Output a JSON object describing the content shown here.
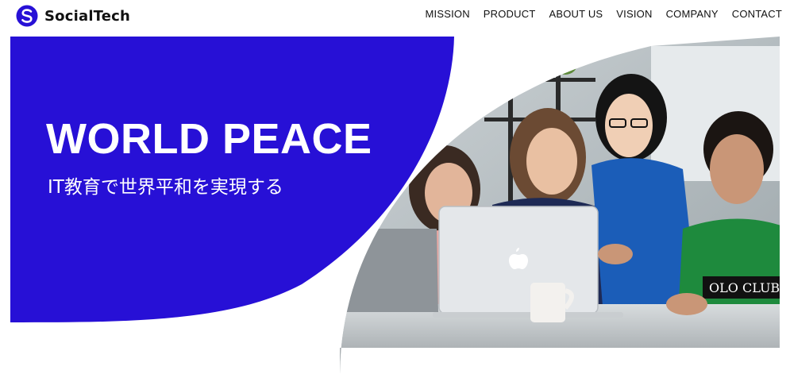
{
  "brand": {
    "name": "SocialTech",
    "logo_icon": "s-circle-logo-icon",
    "accent_color": "#2710d6"
  },
  "nav": {
    "items": [
      {
        "label": "MISSION"
      },
      {
        "label": "PRODUCT"
      },
      {
        "label": "ABOUT US"
      },
      {
        "label": "VISION"
      },
      {
        "label": "COMPANY"
      },
      {
        "label": "CONTACT"
      }
    ]
  },
  "hero": {
    "title": "WORLD PEACE",
    "subtitle": "IT教育で世界平和を実現する",
    "image": "photo-of-four-people-looking-at-laptop",
    "background_color": "#2710d6"
  }
}
